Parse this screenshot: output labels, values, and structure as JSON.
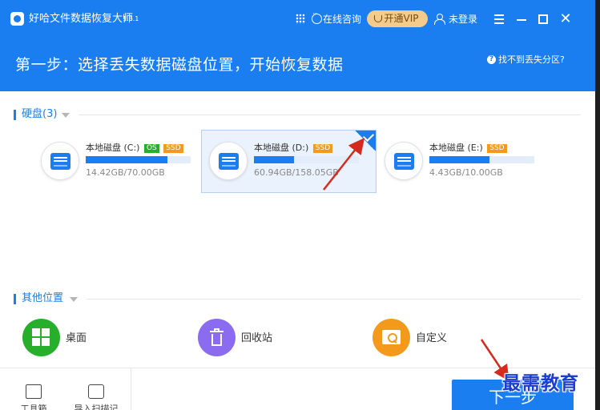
{
  "app": {
    "title": "好哈文件数据恢复大师",
    "version": "1.6.1",
    "online_consult": "在线咨询",
    "vip_button": "开通VIP",
    "login_status": "未登录",
    "close_glyph": "✕"
  },
  "step": {
    "title": "第一步：选择丢失数据磁盘位置，开始恢复数据",
    "help_link": "找不到丢失分区?",
    "help_glyph": "?"
  },
  "disks_section": {
    "title": "硬盘(3)",
    "disks": [
      {
        "name": "本地磁盘 (C:)",
        "badges": [
          "OS",
          "SSD"
        ],
        "size_text": "14.42GB/70.00GB",
        "used_fraction": 0.78,
        "selected": false
      },
      {
        "name": "本地磁盘 (D:)",
        "badges": [
          "SSD"
        ],
        "size_text": "60.94GB/158.05GB",
        "used_fraction": 0.38,
        "selected": true
      },
      {
        "name": "本地磁盘 (E:)",
        "badges": [
          "SSD"
        ],
        "size_text": "4.43GB/10.00GB",
        "used_fraction": 0.57,
        "selected": false
      }
    ]
  },
  "other_section": {
    "title": "其他位置",
    "locations": [
      {
        "label": "桌面",
        "icon": "windows-icon",
        "color": "#27ae2b"
      },
      {
        "label": "回收站",
        "icon": "trash-icon",
        "color": "#8b6cf0"
      },
      {
        "label": "自定义",
        "icon": "folder-search-icon",
        "color": "#f39a1c"
      }
    ]
  },
  "bottom": {
    "tools": [
      {
        "label": "工具箱",
        "icon": "toolbox-icon"
      },
      {
        "label": "导入扫描记录",
        "icon": "import-icon"
      }
    ],
    "next_button": "下一步"
  },
  "watermark": "最需教育",
  "colors": {
    "accent": "#1a7ef0",
    "os_badge": "#27ae2b",
    "ssd_badge": "#f39a1c",
    "annotation": "#d42b1e"
  }
}
